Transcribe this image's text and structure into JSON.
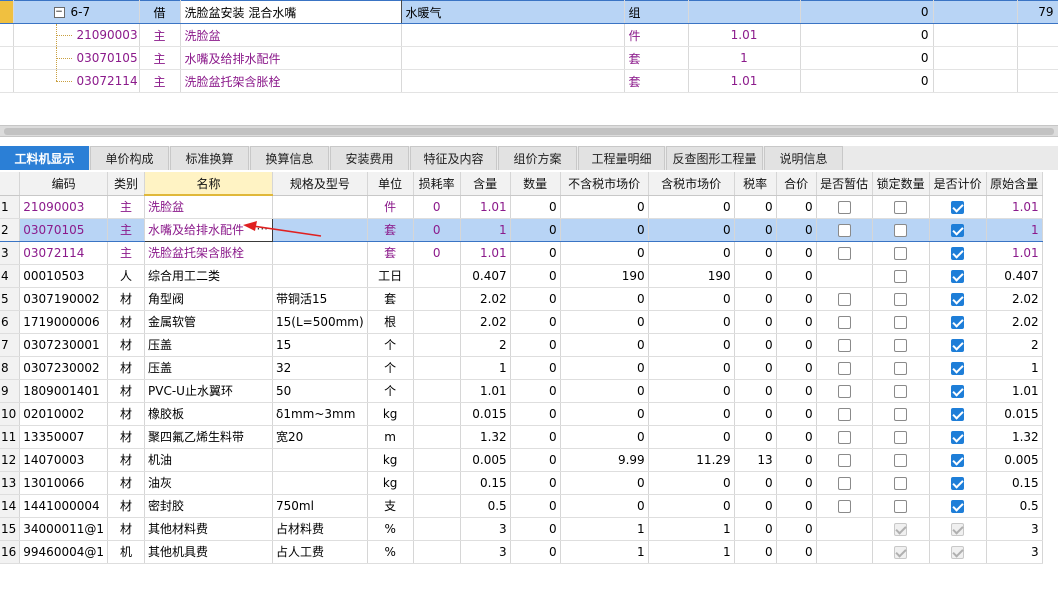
{
  "top_rows": [
    {
      "kind": "parent",
      "code": "6-7",
      "type": "借",
      "name": "洗脸盆安装 混合水嘴",
      "major": "水暖气",
      "unit": "组",
      "qty": "",
      "price": "0",
      "extra": "79"
    },
    {
      "kind": "child",
      "code": "21090003",
      "type": "主",
      "name": "洗脸盆",
      "major": "",
      "unit": "件",
      "qty": "1.01",
      "price": "0",
      "extra": ""
    },
    {
      "kind": "child",
      "code": "03070105",
      "type": "主",
      "name": "水嘴及给排水配件",
      "major": "",
      "unit": "套",
      "qty": "1",
      "price": "0",
      "extra": ""
    },
    {
      "kind": "child",
      "code": "03072114",
      "type": "主",
      "name": "洗脸盆托架含胀栓",
      "major": "",
      "unit": "套",
      "qty": "1.01",
      "price": "0",
      "extra": ""
    }
  ],
  "tabs": [
    {
      "label": "工料机显示",
      "active": true
    },
    {
      "label": "单价构成",
      "active": false
    },
    {
      "label": "标准换算",
      "active": false
    },
    {
      "label": "换算信息",
      "active": false
    },
    {
      "label": "安装费用",
      "active": false
    },
    {
      "label": "特征及内容",
      "active": false
    },
    {
      "label": "组价方案",
      "active": false
    },
    {
      "label": "工程量明细",
      "active": false
    },
    {
      "label": "反查图形工程量",
      "active": false
    },
    {
      "label": "说明信息",
      "active": false
    }
  ],
  "columns": [
    "编码",
    "类别",
    "名称",
    "规格及型号",
    "单位",
    "损耗率",
    "含量",
    "数量",
    "不含税市场价",
    "含税市场价",
    "税率",
    "合价",
    "是否暂估",
    "锁定数量",
    "是否计价",
    "原始含量"
  ],
  "rows": [
    {
      "rn": "1",
      "code": "21090003",
      "type": "主",
      "name": "洗脸盆",
      "spec": "",
      "unit": "件",
      "loss": "0",
      "content": "1.01",
      "amount": "0",
      "p_ex": "0",
      "p_in": "0",
      "tax": "0",
      "total": "0",
      "est": false,
      "lock": false,
      "price_on": true,
      "orig": "1.01",
      "style": "main"
    },
    {
      "rn": "2",
      "code": "03070105",
      "type": "主",
      "name": "水嘴及给排水配件",
      "spec": "",
      "unit": "套",
      "loss": "0",
      "content": "1",
      "amount": "0",
      "p_ex": "0",
      "p_in": "0",
      "tax": "0",
      "total": "0",
      "est": false,
      "lock": false,
      "price_on": true,
      "orig": "1",
      "style": "main"
    },
    {
      "rn": "3",
      "code": "03072114",
      "type": "主",
      "name": "洗脸盆托架含胀栓",
      "spec": "",
      "unit": "套",
      "loss": "0",
      "content": "1.01",
      "amount": "0",
      "p_ex": "0",
      "p_in": "0",
      "tax": "0",
      "total": "0",
      "est": false,
      "lock": false,
      "price_on": true,
      "orig": "1.01",
      "style": "main"
    },
    {
      "rn": "4",
      "code": "00010503",
      "type": "人",
      "name": "综合用工二类",
      "spec": "",
      "unit": "工日",
      "loss": "",
      "content": "0.407",
      "amount": "0",
      "p_ex": "190",
      "p_in": "190",
      "tax": "0",
      "total": "0",
      "est": null,
      "lock": false,
      "price_on": true,
      "orig": "0.407",
      "style": "normal"
    },
    {
      "rn": "5",
      "code": "0307190002",
      "type": "材",
      "name": "角型阀",
      "spec": "带铜活15",
      "unit": "套",
      "loss": "",
      "content": "2.02",
      "amount": "0",
      "p_ex": "0",
      "p_in": "0",
      "tax": "0",
      "total": "0",
      "est": false,
      "lock": false,
      "price_on": true,
      "orig": "2.02",
      "style": "normal"
    },
    {
      "rn": "6",
      "code": "1719000006",
      "type": "材",
      "name": "金属软管",
      "spec": "15(L=500mm)",
      "unit": "根",
      "loss": "",
      "content": "2.02",
      "amount": "0",
      "p_ex": "0",
      "p_in": "0",
      "tax": "0",
      "total": "0",
      "est": false,
      "lock": false,
      "price_on": true,
      "orig": "2.02",
      "style": "normal"
    },
    {
      "rn": "7",
      "code": "0307230001",
      "type": "材",
      "name": "压盖",
      "spec": "15",
      "unit": "个",
      "loss": "",
      "content": "2",
      "amount": "0",
      "p_ex": "0",
      "p_in": "0",
      "tax": "0",
      "total": "0",
      "est": false,
      "lock": false,
      "price_on": true,
      "orig": "2",
      "style": "normal"
    },
    {
      "rn": "8",
      "code": "0307230002",
      "type": "材",
      "name": "压盖",
      "spec": "32",
      "unit": "个",
      "loss": "",
      "content": "1",
      "amount": "0",
      "p_ex": "0",
      "p_in": "0",
      "tax": "0",
      "total": "0",
      "est": false,
      "lock": false,
      "price_on": true,
      "orig": "1",
      "style": "normal"
    },
    {
      "rn": "9",
      "code": "1809001401",
      "type": "材",
      "name": "PVC-U止水翼环",
      "spec": "50",
      "unit": "个",
      "loss": "",
      "content": "1.01",
      "amount": "0",
      "p_ex": "0",
      "p_in": "0",
      "tax": "0",
      "total": "0",
      "est": false,
      "lock": false,
      "price_on": true,
      "orig": "1.01",
      "style": "normal"
    },
    {
      "rn": "10",
      "code": "02010002",
      "type": "材",
      "name": "橡胶板",
      "spec": "δ1mm~3mm",
      "unit": "kg",
      "loss": "",
      "content": "0.015",
      "amount": "0",
      "p_ex": "0",
      "p_in": "0",
      "tax": "0",
      "total": "0",
      "est": false,
      "lock": false,
      "price_on": true,
      "orig": "0.015",
      "style": "normal"
    },
    {
      "rn": "11",
      "code": "13350007",
      "type": "材",
      "name": "聚四氟乙烯生料带",
      "spec": "宽20",
      "unit": "m",
      "loss": "",
      "content": "1.32",
      "amount": "0",
      "p_ex": "0",
      "p_in": "0",
      "tax": "0",
      "total": "0",
      "est": false,
      "lock": false,
      "price_on": true,
      "orig": "1.32",
      "style": "normal"
    },
    {
      "rn": "12",
      "code": "14070003",
      "type": "材",
      "name": "机油",
      "spec": "",
      "unit": "kg",
      "loss": "",
      "content": "0.005",
      "amount": "0",
      "p_ex": "9.99",
      "p_in": "11.29",
      "tax": "13",
      "total": "0",
      "est": false,
      "lock": false,
      "price_on": true,
      "orig": "0.005",
      "style": "normal"
    },
    {
      "rn": "13",
      "code": "13010066",
      "type": "材",
      "name": "油灰",
      "spec": "",
      "unit": "kg",
      "loss": "",
      "content": "0.15",
      "amount": "0",
      "p_ex": "0",
      "p_in": "0",
      "tax": "0",
      "total": "0",
      "est": false,
      "lock": false,
      "price_on": true,
      "orig": "0.15",
      "style": "normal"
    },
    {
      "rn": "14",
      "code": "1441000004",
      "type": "材",
      "name": "密封胶",
      "spec": "750ml",
      "unit": "支",
      "loss": "",
      "content": "0.5",
      "amount": "0",
      "p_ex": "0",
      "p_in": "0",
      "tax": "0",
      "total": "0",
      "est": false,
      "lock": false,
      "price_on": true,
      "orig": "0.5",
      "style": "normal"
    },
    {
      "rn": "15",
      "code": "34000011@1",
      "type": "材",
      "name": "其他材料费",
      "spec": "占材料费",
      "unit": "%",
      "loss": "",
      "content": "3",
      "amount": "0",
      "p_ex": "1",
      "p_in": "1",
      "tax": "0",
      "total": "0",
      "est": null,
      "lock": "disabled",
      "price_on": "disabled",
      "orig": "3",
      "style": "pct"
    },
    {
      "rn": "16",
      "code": "99460004@1",
      "type": "机",
      "name": "其他机具费",
      "spec": "占人工费",
      "unit": "%",
      "loss": "",
      "content": "3",
      "amount": "0",
      "p_ex": "1",
      "p_in": "1",
      "tax": "0",
      "total": "0",
      "est": null,
      "lock": "disabled",
      "price_on": "disabled",
      "orig": "3",
      "style": "pct"
    }
  ],
  "selected_row": "2",
  "highlight_column": "名称"
}
